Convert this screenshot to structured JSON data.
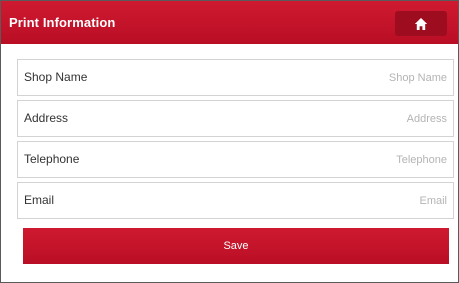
{
  "header": {
    "title": "Print Information",
    "home_icon": "home-icon"
  },
  "form": {
    "fields": [
      {
        "label": "Shop Name",
        "value": "",
        "placeholder": "Shop Name"
      },
      {
        "label": "Address",
        "value": "",
        "placeholder": "Address"
      },
      {
        "label": "Telephone",
        "value": "",
        "placeholder": "Telephone"
      },
      {
        "label": "Email",
        "value": "",
        "placeholder": "Email"
      }
    ],
    "save_label": "Save"
  },
  "colors": {
    "accent": "#c8102e",
    "button_dark": "#9e0c1f"
  }
}
